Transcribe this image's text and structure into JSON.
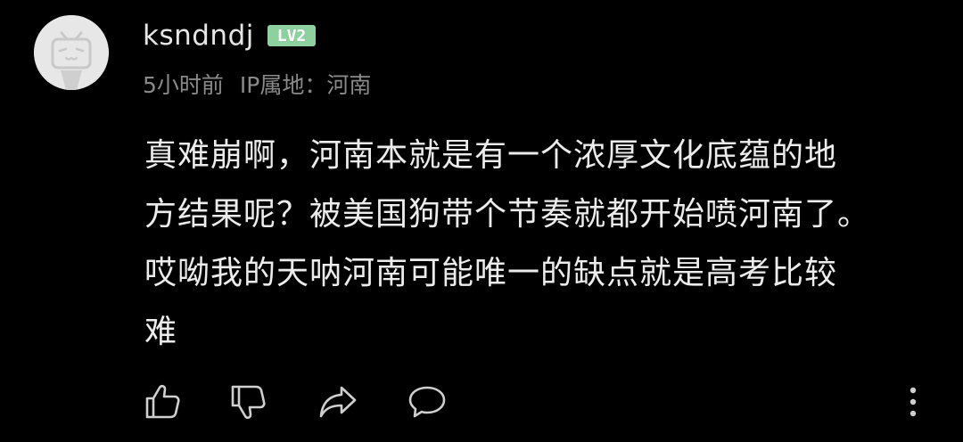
{
  "comment": {
    "user": {
      "name": "ksndndj",
      "level_badge": "LV2",
      "level_color": "#8fd19e",
      "avatar_icon": "bilibili-tv-avatar-icon"
    },
    "meta": {
      "time": "5小时前",
      "ip_location": "IP属地：河南"
    },
    "text_lines": [
      "真难崩啊，河南本就是有一个浓厚文化底蕴的地",
      "方结果呢？被美国狗带个节奏就都开始喷河南了。",
      "哎呦我的天呐河南可能唯一的缺点就是高考比较",
      "难"
    ],
    "actions": {
      "like_icon": "thumbs-up-icon",
      "dislike_icon": "thumbs-down-icon",
      "share_icon": "share-icon",
      "reply_icon": "reply-bubble-icon",
      "more_icon": "more-vertical-icon"
    }
  },
  "colors": {
    "background": "#000000",
    "text_primary": "#ececec",
    "text_secondary": "#8a8a8a",
    "icon": "#cfcfcf"
  }
}
